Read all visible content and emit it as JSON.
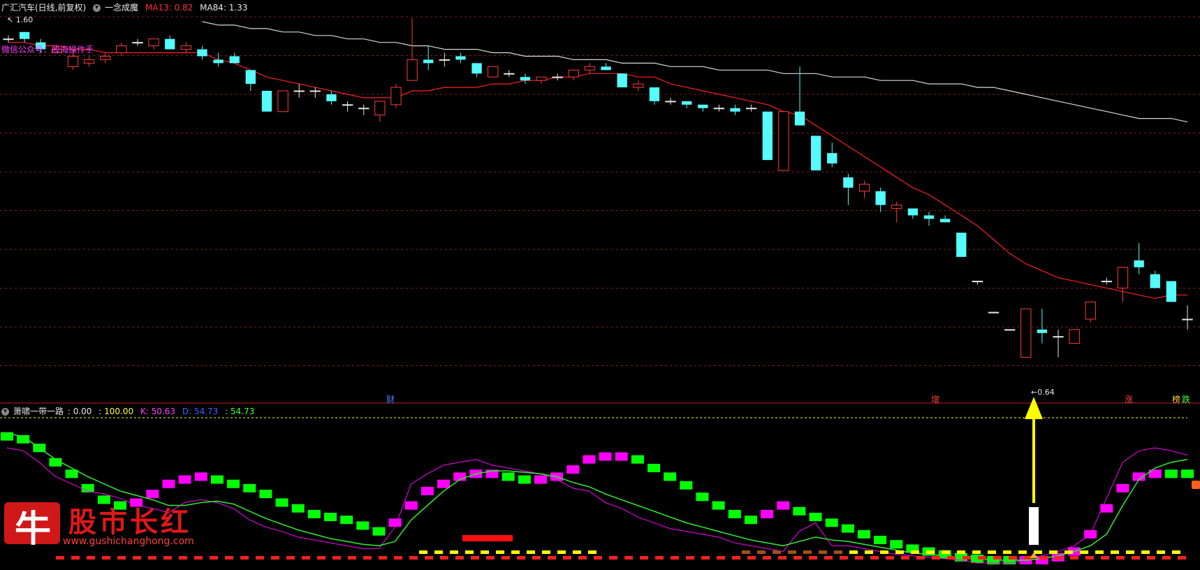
{
  "main_header": {
    "stock": "广汇汽车(日线,前复权)",
    "indicator": "一念成魔",
    "ma13_label": "MA13: 0.82",
    "ma84_label": "MA84: 1.33",
    "price_top_label": "1.60",
    "price_low_label": "0.64",
    "wechat_note": "微信公众号：股海操作手"
  },
  "markers": {
    "cai": "财",
    "zeng": "增",
    "zhang": "涨",
    "die": "跌",
    "ban": "榜"
  },
  "sub_header": {
    "title": "萧啸一带一路",
    "v1": ": 0.00",
    "v2": ": 100.00",
    "k": "K: 50.63",
    "d": "D: 54.73",
    "j": ": 54.73"
  },
  "watermark": {
    "logo_char": "牛",
    "name": "股市长红",
    "url": "www.gushichanghong.com"
  },
  "colors": {
    "up": "#ff3b3b",
    "down": "#54fcfc",
    "ma13": "#ff2020",
    "ma84": "#d8d8d8",
    "grid": "#8b1a1a",
    "magenta": "#ff00ff",
    "green": "#00ff00",
    "yellow": "#ffff00"
  },
  "chart_data": {
    "type": "candlestick",
    "candles": [
      [
        1.56,
        1.57,
        1.55,
        1.56
      ],
      [
        1.58,
        1.58,
        1.55,
        1.56
      ],
      [
        1.55,
        1.56,
        1.52,
        1.53
      ],
      [
        1.52,
        1.54,
        1.52,
        1.53
      ],
      [
        1.48,
        1.52,
        1.47,
        1.51
      ],
      [
        1.49,
        1.51,
        1.48,
        1.5
      ],
      [
        1.5,
        1.52,
        1.49,
        1.51
      ],
      [
        1.52,
        1.55,
        1.51,
        1.54
      ],
      [
        1.55,
        1.56,
        1.54,
        1.55
      ],
      [
        1.54,
        1.56,
        1.53,
        1.56
      ],
      [
        1.56,
        1.57,
        1.53,
        1.53
      ],
      [
        1.53,
        1.55,
        1.52,
        1.54
      ],
      [
        1.53,
        1.54,
        1.5,
        1.51
      ],
      [
        1.5,
        1.52,
        1.48,
        1.49
      ],
      [
        1.51,
        1.52,
        1.49,
        1.49
      ],
      [
        1.47,
        1.47,
        1.41,
        1.43
      ],
      [
        1.41,
        1.41,
        1.35,
        1.35
      ],
      [
        1.35,
        1.41,
        1.35,
        1.41
      ],
      [
        1.41,
        1.43,
        1.39,
        1.41
      ],
      [
        1.41,
        1.42,
        1.39,
        1.41
      ],
      [
        1.4,
        1.41,
        1.37,
        1.38
      ],
      [
        1.37,
        1.38,
        1.35,
        1.37
      ],
      [
        1.36,
        1.37,
        1.34,
        1.36
      ],
      [
        1.34,
        1.38,
        1.32,
        1.38
      ],
      [
        1.37,
        1.43,
        1.36,
        1.42
      ],
      [
        1.44,
        1.62,
        1.44,
        1.5
      ],
      [
        1.5,
        1.54,
        1.47,
        1.49
      ],
      [
        1.5,
        1.52,
        1.48,
        1.5
      ],
      [
        1.51,
        1.52,
        1.49,
        1.5
      ],
      [
        1.49,
        1.49,
        1.45,
        1.46
      ],
      [
        1.45,
        1.48,
        1.45,
        1.48
      ],
      [
        1.46,
        1.47,
        1.45,
        1.46
      ],
      [
        1.45,
        1.46,
        1.43,
        1.44
      ],
      [
        1.44,
        1.45,
        1.43,
        1.45
      ],
      [
        1.45,
        1.46,
        1.44,
        1.45
      ],
      [
        1.45,
        1.47,
        1.44,
        1.47
      ],
      [
        1.47,
        1.49,
        1.46,
        1.48
      ],
      [
        1.48,
        1.49,
        1.47,
        1.47
      ],
      [
        1.46,
        1.46,
        1.42,
        1.42
      ],
      [
        1.42,
        1.44,
        1.41,
        1.43
      ],
      [
        1.42,
        1.42,
        1.37,
        1.38
      ],
      [
        1.38,
        1.39,
        1.37,
        1.38
      ],
      [
        1.38,
        1.38,
        1.36,
        1.37
      ],
      [
        1.37,
        1.37,
        1.35,
        1.36
      ],
      [
        1.36,
        1.37,
        1.35,
        1.36
      ],
      [
        1.36,
        1.37,
        1.34,
        1.35
      ],
      [
        1.36,
        1.37,
        1.35,
        1.36
      ],
      [
        1.35,
        1.35,
        1.21,
        1.21
      ],
      [
        1.18,
        1.35,
        1.18,
        1.35
      ],
      [
        1.35,
        1.48,
        1.31,
        1.31
      ],
      [
        1.28,
        1.28,
        1.18,
        1.18
      ],
      [
        1.23,
        1.26,
        1.19,
        1.2
      ],
      [
        1.16,
        1.17,
        1.08,
        1.13
      ],
      [
        1.12,
        1.15,
        1.1,
        1.14
      ],
      [
        1.12,
        1.13,
        1.06,
        1.08
      ],
      [
        1.07,
        1.09,
        1.03,
        1.08
      ],
      [
        1.07,
        1.07,
        1.04,
        1.05
      ],
      [
        1.05,
        1.06,
        1.02,
        1.04
      ],
      [
        1.04,
        1.05,
        1.03,
        1.03
      ],
      [
        1.0,
        1.0,
        0.93,
        0.93
      ],
      [
        0.86,
        0.86,
        0.85,
        0.86
      ],
      [
        0.77,
        0.77,
        0.77,
        0.77
      ],
      [
        0.72,
        0.72,
        0.72,
        0.72
      ],
      [
        0.64,
        0.78,
        0.64,
        0.78
      ],
      [
        0.72,
        0.78,
        0.68,
        0.71
      ],
      [
        0.7,
        0.72,
        0.64,
        0.7
      ],
      [
        0.68,
        0.72,
        0.68,
        0.72
      ],
      [
        0.75,
        0.8,
        0.74,
        0.8
      ],
      [
        0.86,
        0.87,
        0.85,
        0.86
      ],
      [
        0.84,
        0.9,
        0.8,
        0.9
      ],
      [
        0.92,
        0.97,
        0.88,
        0.9
      ],
      [
        0.88,
        0.89,
        0.84,
        0.84
      ],
      [
        0.86,
        0.86,
        0.8,
        0.8
      ],
      [
        0.75,
        0.79,
        0.72,
        0.75
      ]
    ],
    "ma13": [
      1.55,
      1.55,
      1.54,
      1.54,
      1.53,
      1.53,
      1.52,
      1.52,
      1.52,
      1.52,
      1.52,
      1.52,
      1.52,
      1.5,
      1.49,
      1.47,
      1.45,
      1.44,
      1.43,
      1.42,
      1.41,
      1.4,
      1.39,
      1.39,
      1.39,
      1.41,
      1.41,
      1.42,
      1.42,
      1.42,
      1.43,
      1.43,
      1.44,
      1.44,
      1.45,
      1.45,
      1.46,
      1.46,
      1.46,
      1.45,
      1.45,
      1.43,
      1.42,
      1.41,
      1.4,
      1.39,
      1.38,
      1.37,
      1.35,
      1.34,
      1.31,
      1.28,
      1.25,
      1.22,
      1.19,
      1.16,
      1.13,
      1.11,
      1.08,
      1.05,
      1.02,
      0.98,
      0.94,
      0.91,
      0.89,
      0.87,
      0.86,
      0.85,
      0.84,
      0.83,
      0.82,
      0.81,
      0.82,
      0.82
    ],
    "ma84": {
      "from_index": 12,
      "values": [
        1.61,
        1.6,
        1.6,
        1.59,
        1.59,
        1.58,
        1.58,
        1.57,
        1.57,
        1.56,
        1.56,
        1.55,
        1.55,
        1.54,
        1.54,
        1.53,
        1.53,
        1.53,
        1.52,
        1.52,
        1.51,
        1.51,
        1.51,
        1.5,
        1.5,
        1.5,
        1.49,
        1.49,
        1.49,
        1.48,
        1.48,
        1.48,
        1.47,
        1.47,
        1.47,
        1.47,
        1.46,
        1.46,
        1.46,
        1.45,
        1.45,
        1.45,
        1.44,
        1.44,
        1.44,
        1.43,
        1.43,
        1.43,
        1.42,
        1.42,
        1.41,
        1.4,
        1.39,
        1.38,
        1.37,
        1.36,
        1.35,
        1.34,
        1.33,
        1.33,
        1.33,
        1.32
      ]
    },
    "ylim": [
      0.55,
      1.62
    ],
    "sub": {
      "ylim": [
        0,
        100
      ],
      "k": [
        80,
        78,
        70,
        60,
        55,
        50,
        48,
        45,
        40,
        38,
        35,
        42,
        44,
        42,
        38,
        30,
        25,
        22,
        18,
        16,
        14,
        12,
        10,
        10,
        25,
        55,
        62,
        68,
        70,
        72,
        68,
        66,
        64,
        62,
        58,
        52,
        50,
        42,
        38,
        32,
        28,
        24,
        22,
        20,
        18,
        14,
        12,
        10,
        8,
        22,
        28,
        12,
        12,
        10,
        8,
        6,
        5,
        4,
        3,
        2,
        0,
        0,
        0,
        2,
        5,
        8,
        12,
        20,
        45,
        70,
        78,
        80,
        78,
        75
      ],
      "d": [
        90,
        88,
        80,
        72,
        66,
        60,
        55,
        50,
        47,
        44,
        40,
        40,
        42,
        43,
        41,
        36,
        31,
        27,
        23,
        20,
        17,
        15,
        13,
        12,
        15,
        30,
        40,
        50,
        58,
        62,
        64,
        64,
        63,
        62,
        60,
        56,
        53,
        48,
        44,
        40,
        36,
        32,
        28,
        25,
        22,
        19,
        16,
        14,
        12,
        15,
        18,
        16,
        15,
        13,
        11,
        9,
        7,
        6,
        5,
        4,
        3,
        2,
        2,
        2,
        3,
        5,
        8,
        12,
        20,
        40,
        58,
        66,
        70,
        72
      ],
      "blocks": [
        {
          "v": 88,
          "c": "g"
        },
        {
          "v": 86,
          "c": "g"
        },
        {
          "v": 80,
          "c": "g"
        },
        {
          "v": 70,
          "c": "g"
        },
        {
          "v": 62,
          "c": "g"
        },
        {
          "v": 52,
          "c": "g"
        },
        {
          "v": 44,
          "c": "g"
        },
        {
          "v": 40,
          "c": "g"
        },
        {
          "v": 42,
          "c": "m"
        },
        {
          "v": 48,
          "c": "m"
        },
        {
          "v": 55,
          "c": "m"
        },
        {
          "v": 58,
          "c": "m"
        },
        {
          "v": 60,
          "c": "m"
        },
        {
          "v": 58,
          "c": "g"
        },
        {
          "v": 55,
          "c": "g"
        },
        {
          "v": 52,
          "c": "g"
        },
        {
          "v": 48,
          "c": "g"
        },
        {
          "v": 42,
          "c": "g"
        },
        {
          "v": 38,
          "c": "g"
        },
        {
          "v": 34,
          "c": "g"
        },
        {
          "v": 32,
          "c": "g"
        },
        {
          "v": 30,
          "c": "g"
        },
        {
          "v": 26,
          "c": "g"
        },
        {
          "v": 22,
          "c": "g"
        },
        {
          "v": 28,
          "c": "m"
        },
        {
          "v": 40,
          "c": "m"
        },
        {
          "v": 50,
          "c": "m"
        },
        {
          "v": 55,
          "c": "m"
        },
        {
          "v": 60,
          "c": "m"
        },
        {
          "v": 62,
          "c": "m"
        },
        {
          "v": 62,
          "c": "m"
        },
        {
          "v": 60,
          "c": "g"
        },
        {
          "v": 58,
          "c": "g"
        },
        {
          "v": 58,
          "c": "m"
        },
        {
          "v": 60,
          "c": "m"
        },
        {
          "v": 65,
          "c": "m"
        },
        {
          "v": 72,
          "c": "m"
        },
        {
          "v": 74,
          "c": "m"
        },
        {
          "v": 74,
          "c": "m"
        },
        {
          "v": 72,
          "c": "g"
        },
        {
          "v": 66,
          "c": "g"
        },
        {
          "v": 60,
          "c": "g"
        },
        {
          "v": 54,
          "c": "g"
        },
        {
          "v": 46,
          "c": "g"
        },
        {
          "v": 40,
          "c": "g"
        },
        {
          "v": 34,
          "c": "g"
        },
        {
          "v": 30,
          "c": "g"
        },
        {
          "v": 34,
          "c": "m"
        },
        {
          "v": 40,
          "c": "m"
        },
        {
          "v": 36,
          "c": "g"
        },
        {
          "v": 32,
          "c": "g"
        },
        {
          "v": 28,
          "c": "g"
        },
        {
          "v": 24,
          "c": "g"
        },
        {
          "v": 20,
          "c": "g"
        },
        {
          "v": 16,
          "c": "g"
        },
        {
          "v": 13,
          "c": "g"
        },
        {
          "v": 10,
          "c": "g"
        },
        {
          "v": 8,
          "c": "g"
        },
        {
          "v": 6,
          "c": "g"
        },
        {
          "v": 4,
          "c": "g"
        },
        {
          "v": 3,
          "c": "g"
        },
        {
          "v": 2,
          "c": "g"
        },
        {
          "v": 2,
          "c": "g"
        },
        {
          "v": 2,
          "c": "m"
        },
        {
          "v": 2,
          "c": "m"
        },
        {
          "v": 4,
          "c": "m"
        },
        {
          "v": 8,
          "c": "m"
        },
        {
          "v": 20,
          "c": "m"
        },
        {
          "v": 38,
          "c": "m"
        },
        {
          "v": 52,
          "c": "m"
        },
        {
          "v": 60,
          "c": "m"
        },
        {
          "v": 62,
          "c": "m"
        },
        {
          "v": 62,
          "c": "g"
        },
        {
          "v": 62,
          "c": "g"
        }
      ]
    }
  }
}
